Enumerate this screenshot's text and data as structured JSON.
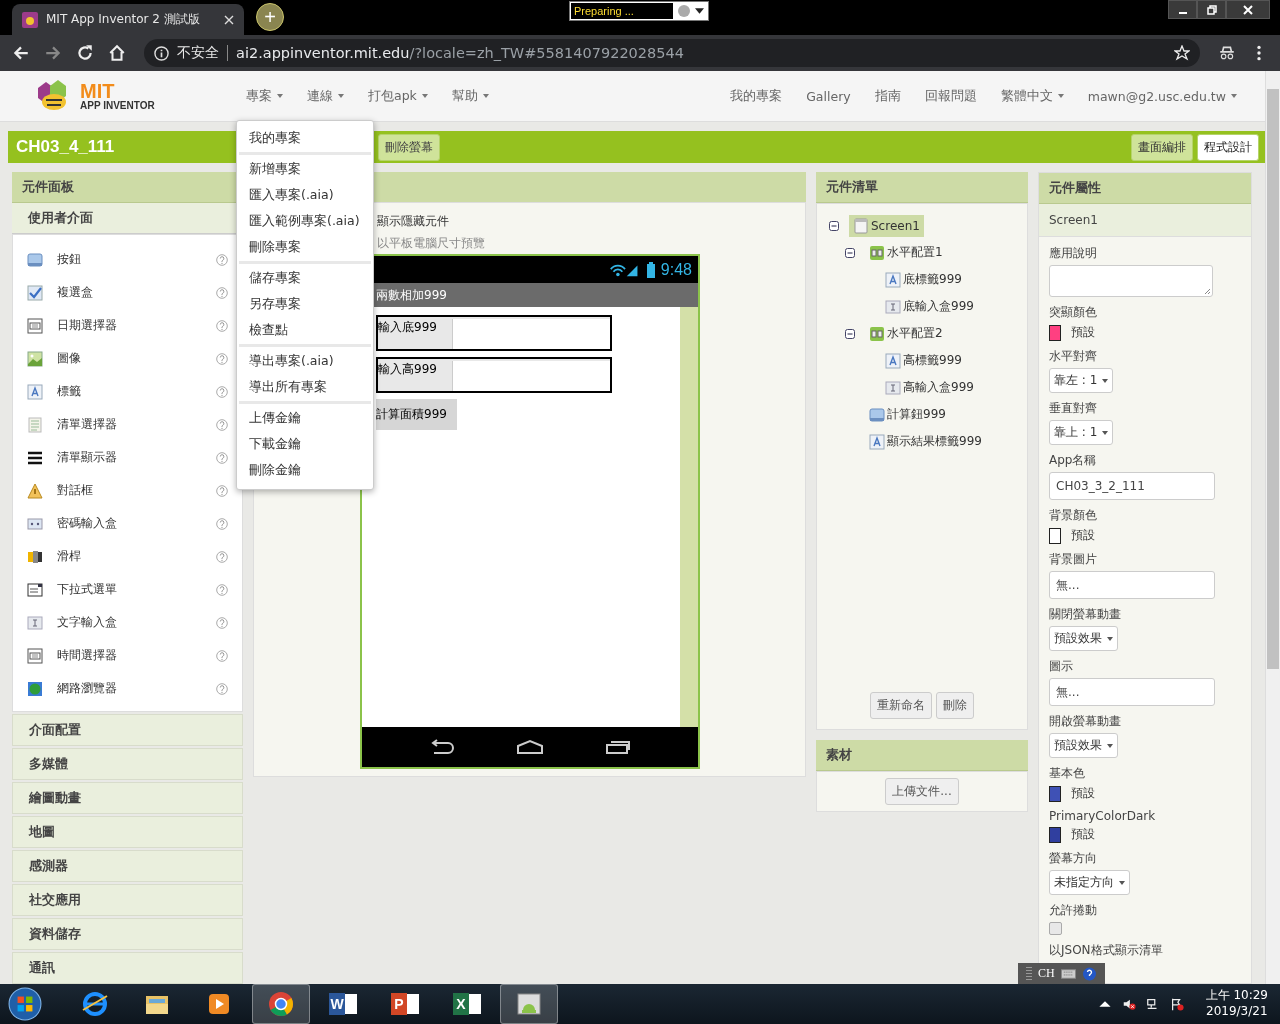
{
  "browser": {
    "tab_title": "MIT App Inventor 2 測試版",
    "new_tab": "+",
    "warning": "不安全",
    "url_host": "ai2.appinventor.mit.edu",
    "url_rest": "/?locale=zh_TW#5581407922028544"
  },
  "status_popup": {
    "text": "Preparing ..."
  },
  "app_header": {
    "logo_top": "MIT",
    "logo_bottom": "APP INVENTOR",
    "menus": [
      {
        "label": "專案",
        "caret": true
      },
      {
        "label": "連線",
        "caret": true
      },
      {
        "label": "打包apk",
        "caret": true
      },
      {
        "label": "幫助",
        "caret": true
      }
    ],
    "links": [
      {
        "label": "我的專案",
        "caret": false
      },
      {
        "label": "Gallery",
        "caret": false
      },
      {
        "label": "指南",
        "caret": false
      },
      {
        "label": "回報問題",
        "caret": false
      },
      {
        "label": "繁體中文",
        "caret": true
      },
      {
        "label": "mawn@g2.usc.edu.tw",
        "caret": true
      }
    ]
  },
  "project_bar": {
    "title": "CH03_4_111",
    "delete_screen": "刪除螢幕",
    "modes": [
      {
        "label": "畫面編排",
        "selected": true
      },
      {
        "label": "程式設計",
        "selected": false
      }
    ]
  },
  "project_menu": {
    "groups": [
      [
        "我的專案"
      ],
      [
        "新增專案",
        "匯入專案(.aia)",
        "匯入範例專案(.aia)",
        "刪除專案"
      ],
      [
        "儲存專案",
        "另存專案",
        "檢查點"
      ],
      [
        "導出專案(.aia)",
        "導出所有專案"
      ],
      [
        "上傳金鑰",
        "下載金鑰",
        "刪除金鑰"
      ]
    ]
  },
  "palette": {
    "title": "元件面板",
    "section": "使用者介面",
    "items": [
      {
        "label": "按鈕",
        "kind": "button"
      },
      {
        "label": "複選盒",
        "kind": "checkbox"
      },
      {
        "label": "日期選擇器",
        "kind": "datepicker"
      },
      {
        "label": "圖像",
        "kind": "image"
      },
      {
        "label": "標籤",
        "kind": "label"
      },
      {
        "label": "清單選擇器",
        "kind": "listpicker"
      },
      {
        "label": "清單顯示器",
        "kind": "listview"
      },
      {
        "label": "對話框",
        "kind": "notifier"
      },
      {
        "label": "密碼輸入盒",
        "kind": "password"
      },
      {
        "label": "滑桿",
        "kind": "slider"
      },
      {
        "label": "下拉式選單",
        "kind": "spinner"
      },
      {
        "label": "文字輸入盒",
        "kind": "textbox"
      },
      {
        "label": "時間選擇器",
        "kind": "timepicker"
      },
      {
        "label": "網路瀏覽器",
        "kind": "webviewer"
      }
    ],
    "categories": [
      "介面配置",
      "多媒體",
      "繪圖動畫",
      "地圖",
      "感測器",
      "社交應用",
      "資料儲存",
      "通訊"
    ]
  },
  "viewer": {
    "toggles": [
      "顯示隱藏元件",
      "以平板電腦尺寸預覽"
    ],
    "phone": {
      "time": "9:48",
      "title": "兩數相加999",
      "rows": [
        {
          "label": "輸入底999"
        },
        {
          "label": "輸入高999"
        }
      ],
      "button": "計算面積999"
    }
  },
  "components": {
    "title": "元件清單",
    "tree": [
      {
        "label": "Screen1",
        "kind": "screen",
        "selected": true,
        "expanded": true,
        "children": [
          {
            "label": "水平配置1",
            "kind": "arrangement",
            "selected": false,
            "expanded": true,
            "children": [
              {
                "label": "底標籤999",
                "kind": "label",
                "selected": false
              },
              {
                "label": "底輸入盒999",
                "kind": "textbox",
                "selected": false
              }
            ]
          },
          {
            "label": "水平配置2",
            "kind": "arrangement",
            "selected": false,
            "expanded": true,
            "children": [
              {
                "label": "高標籤999",
                "kind": "label",
                "selected": false
              },
              {
                "label": "高輸入盒999",
                "kind": "textbox",
                "selected": false
              }
            ]
          },
          {
            "label": "計算鈕999",
            "kind": "button",
            "selected": false
          },
          {
            "label": "顯示結果標籤999",
            "kind": "label",
            "selected": false
          }
        ]
      }
    ],
    "buttons": [
      "重新命名",
      "刪除"
    ]
  },
  "assets": {
    "title": "素材",
    "button": "上傳文件..."
  },
  "properties": {
    "title": "元件屬性",
    "component": "Screen1",
    "items": [
      {
        "kind": "textarea",
        "label": "應用說明"
      },
      {
        "kind": "color",
        "label": "突顯顏色",
        "value": "預設",
        "color": "#ff4081"
      },
      {
        "kind": "dropdown",
        "label": "水平對齊",
        "value": "靠左 : 1"
      },
      {
        "kind": "dropdown",
        "label": "垂直對齊",
        "value": "靠上 : 1"
      },
      {
        "kind": "text",
        "label": "App名稱",
        "value": "CH03_3_2_111"
      },
      {
        "kind": "color",
        "label": "背景顏色",
        "value": "預設",
        "color": "#ffffff"
      },
      {
        "kind": "asset",
        "label": "背景圖片",
        "value": "無..."
      },
      {
        "kind": "dropdown",
        "label": "關閉螢幕動畫",
        "value": "預設效果"
      },
      {
        "kind": "asset",
        "label": "圖示",
        "value": "無..."
      },
      {
        "kind": "dropdown",
        "label": "開啟螢幕動畫",
        "value": "預設效果"
      },
      {
        "kind": "color",
        "label": "基本色",
        "value": "預設",
        "color": "#3f51b5"
      },
      {
        "kind": "color",
        "label": "PrimaryColorDark",
        "value": "預設",
        "color": "#303f9f"
      },
      {
        "kind": "dropdown",
        "label": "螢幕方向",
        "value": "未指定方向"
      },
      {
        "kind": "checkbox",
        "label": "允許捲動",
        "checked": false
      },
      {
        "kind": "heading",
        "label": "以JSON格式顯示清單"
      }
    ]
  },
  "ime_bar": {
    "text": "CH"
  },
  "taskbar": {
    "apps": [
      {
        "kind": "globe",
        "selected": false
      },
      {
        "kind": "folder",
        "selected": false
      },
      {
        "kind": "media",
        "selected": false
      },
      {
        "kind": "chrome",
        "selected": true
      },
      {
        "kind": "doc",
        "letter": "W",
        "selected": false
      },
      {
        "kind": "slides",
        "letter": "P",
        "selected": false
      },
      {
        "kind": "sheet",
        "letter": "X",
        "selected": false
      },
      {
        "kind": "emulator",
        "selected": true
      }
    ],
    "time": "上午 10:29",
    "date": "2019/3/21"
  }
}
